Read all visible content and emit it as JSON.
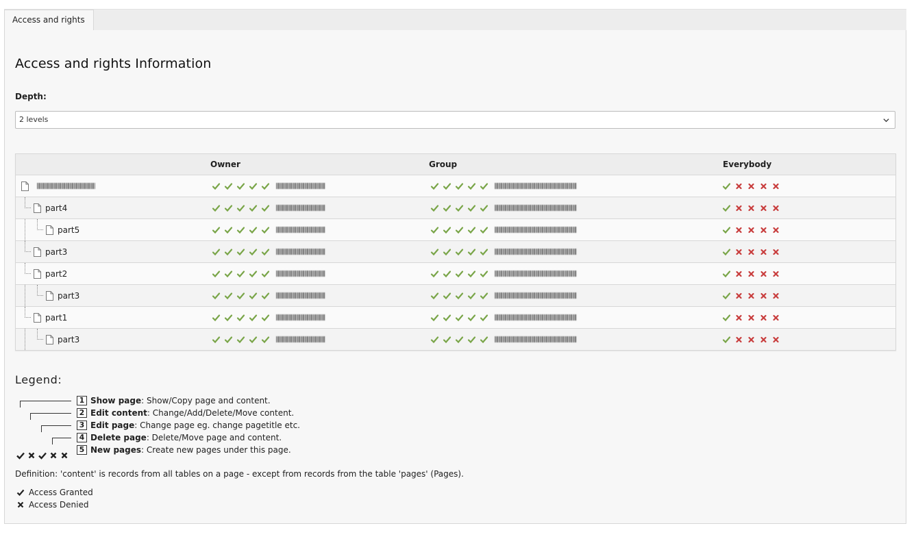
{
  "tabs": [
    {
      "label": "Access and rights"
    }
  ],
  "title": "Access and rights Information",
  "depth": {
    "label": "Depth:",
    "selected": "2 levels"
  },
  "table": {
    "headers": [
      "",
      "Owner",
      "Group",
      "Everybody"
    ],
    "rows": [
      {
        "label": "",
        "level": 0,
        "owner": [
          1,
          1,
          1,
          1,
          1
        ],
        "group": [
          1,
          1,
          1,
          1,
          1
        ],
        "everybody": [
          1,
          0,
          0,
          0,
          0
        ]
      },
      {
        "label": "part4",
        "level": 1,
        "owner": [
          1,
          1,
          1,
          1,
          1
        ],
        "group": [
          1,
          1,
          1,
          1,
          1
        ],
        "everybody": [
          1,
          0,
          0,
          0,
          0
        ]
      },
      {
        "label": "part5",
        "level": 2,
        "owner": [
          1,
          1,
          1,
          1,
          1
        ],
        "group": [
          1,
          1,
          1,
          1,
          1
        ],
        "everybody": [
          1,
          0,
          0,
          0,
          0
        ]
      },
      {
        "label": "part3",
        "level": 1,
        "owner": [
          1,
          1,
          1,
          1,
          1
        ],
        "group": [
          1,
          1,
          1,
          1,
          1
        ],
        "everybody": [
          1,
          0,
          0,
          0,
          0
        ]
      },
      {
        "label": "part2",
        "level": 1,
        "owner": [
          1,
          1,
          1,
          1,
          1
        ],
        "group": [
          1,
          1,
          1,
          1,
          1
        ],
        "everybody": [
          1,
          0,
          0,
          0,
          0
        ]
      },
      {
        "label": "part3",
        "level": 2,
        "owner": [
          1,
          1,
          1,
          1,
          1
        ],
        "group": [
          1,
          1,
          1,
          1,
          1
        ],
        "everybody": [
          1,
          0,
          0,
          0,
          0
        ]
      },
      {
        "label": "part1",
        "level": 1,
        "owner": [
          1,
          1,
          1,
          1,
          1
        ],
        "group": [
          1,
          1,
          1,
          1,
          1
        ],
        "everybody": [
          1,
          0,
          0,
          0,
          0
        ]
      },
      {
        "label": "part3",
        "level": 2,
        "owner": [
          1,
          1,
          1,
          1,
          1
        ],
        "group": [
          1,
          1,
          1,
          1,
          1
        ],
        "everybody": [
          1,
          0,
          0,
          0,
          0
        ]
      }
    ]
  },
  "legend": {
    "title": "Legend:",
    "items": [
      {
        "num": "1",
        "name": "Show page",
        "desc": ": Show/Copy page and content."
      },
      {
        "num": "2",
        "name": "Edit content",
        "desc": ": Change/Add/Delete/Move content."
      },
      {
        "num": "3",
        "name": "Edit page",
        "desc": ": Change page eg. change pagetitle etc."
      },
      {
        "num": "4",
        "name": "Delete page",
        "desc": ": Delete/Move page and content."
      },
      {
        "num": "5",
        "name": "New pages",
        "desc": ": Create new pages under this page."
      }
    ],
    "sample": [
      1,
      0,
      1,
      0,
      0
    ]
  },
  "definition": "Definition: 'content' is records from all tables on a page - except from records from the table 'pages' (Pages).",
  "key": {
    "granted": "Access Granted",
    "denied": "Access Denied"
  },
  "colors": {
    "granted": "#79a548",
    "denied": "#c83c3c",
    "legend_icon": "#212121"
  },
  "icons": {
    "page": "page-icon",
    "granted": "check-icon",
    "denied": "cross-icon",
    "select": "chevron-down-icon"
  }
}
